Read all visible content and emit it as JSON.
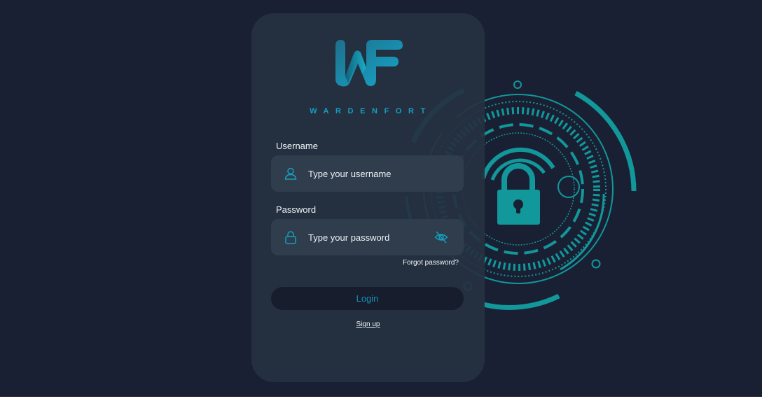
{
  "brand": {
    "name": "WARDENFORT",
    "logo_text": "WF"
  },
  "form": {
    "username_label": "Username",
    "username_placeholder": "Type your username",
    "username_value": "",
    "password_label": "Password",
    "password_placeholder": "Type your password",
    "password_value": "",
    "forgot_link": "Forgot password?",
    "login_button": "Login",
    "signup_link": "Sign up"
  },
  "icons": {
    "username": "user-icon",
    "password": "lock-icon",
    "visibility": "eye-off-icon",
    "illustration": "padlock-icon"
  },
  "colors": {
    "background": "#1a2033",
    "card": "#263242",
    "field": "#2f3d4c",
    "accent": "#169fbe",
    "illustration": "#12979a",
    "button": "#171d2d"
  }
}
